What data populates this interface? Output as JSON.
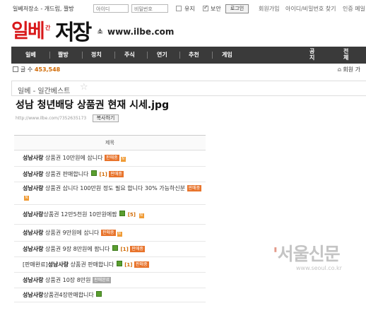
{
  "topbar": {
    "site_link": "일베저장소 - 개드립, 짤방",
    "id_placeholder": "아이디",
    "pw_placeholder": "비밀번호",
    "keep_label": "유지",
    "secure_label": "보안",
    "login_label": "로그인",
    "register": "회원가입",
    "find_account": "아이디/비밀번호 찾기",
    "auth_mail": "인증 메일"
  },
  "logo": {
    "red_text": "일베",
    "mini_top": "간",
    "mini_right": "소",
    "black_text": "저장",
    "url": "www.ilbe.com"
  },
  "nav": {
    "items": [
      "일베",
      "짤방",
      "정치",
      "주식",
      "연기",
      "추천",
      "게임"
    ],
    "notice": "공지",
    "all": "전체"
  },
  "stats": {
    "label": "글 수",
    "count": "453,548",
    "right": "회원 가"
  },
  "section": {
    "title": "일베 - 일간베스트",
    "star": "☆"
  },
  "post": {
    "title": "성남 청년배당 상품권 현재 시세.jpg",
    "url": "http://www.ilbe.com/7352635173",
    "copy_label": "복사하기"
  },
  "table": {
    "header": "제목",
    "rows": [
      {
        "author": "성남사랑",
        "text": " 상품권 10만원에 삽니다 ",
        "img": false,
        "comments": "",
        "tag": "판매중",
        "tag_gray": false,
        "new": true
      },
      {
        "author": "성남사랑",
        "text": " 상품권 판매합니다 ",
        "img": true,
        "comments": "[1]",
        "tag": "판매중",
        "tag_gray": false,
        "new": false
      },
      {
        "author": "성남사랑",
        "text": " 상품권 삽니다 100만원 정도 필요 합니다 30% 가능하신분 ",
        "img": false,
        "comments": "",
        "tag": "판매중",
        "tag_gray": false,
        "new": true
      },
      {
        "author": "성남사랑",
        "text": "상품권 12만5천원 10만원에팜 ",
        "img": true,
        "comments": "[5]",
        "tag": "",
        "tag_gray": false,
        "new": true
      },
      {
        "author": "성남사랑",
        "text": " 상품권 9만원에 삽니다 ",
        "img": false,
        "comments": "",
        "tag": "판매중",
        "tag_gray": false,
        "new": true
      },
      {
        "author": "성남사랑",
        "text": " 상품권 9장 8만원에 팝니다 ",
        "img": true,
        "comments": "[1]",
        "tag": "판매중",
        "tag_gray": false,
        "new": false
      },
      {
        "author": "성남사랑",
        "text": " 상품권 판매합니다 ",
        "prefix": "[판매완료]",
        "img": true,
        "comments": "[1]",
        "tag": "판매중",
        "tag_gray": false,
        "new": false
      },
      {
        "author": "성남사랑",
        "text": " 상품권 10장 8만원 ",
        "img": false,
        "comments": "",
        "tag": "판매완료",
        "tag_gray": true,
        "new": false
      },
      {
        "author": "성남사랑",
        "text": "상품권4장판매합니다 ",
        "img": true,
        "comments": "",
        "tag": "",
        "tag_gray": false,
        "new": false
      }
    ]
  },
  "watermark": {
    "text_accent": "'",
    "text": "서울신문",
    "url": "www.seoul.co.kr"
  },
  "colors": {
    "brand_red": "#d8181a",
    "nav_bg": "#3a3a3a",
    "tag_orange": "#e8742c",
    "count_orange": "#d06800"
  }
}
